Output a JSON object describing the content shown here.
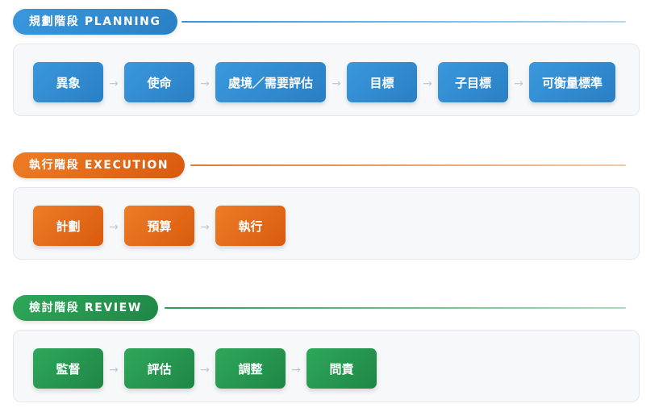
{
  "stages": [
    {
      "title": "規劃階段 PLANNING",
      "color": "#2f8ad0",
      "steps": [
        "異象",
        "使命",
        "處境／需要評估",
        "目標",
        "子目標",
        "可衡量標準"
      ]
    },
    {
      "title": "執行階段 EXECUTION",
      "color": "#e3681a",
      "steps": [
        "計劃",
        "預算",
        "執行"
      ]
    },
    {
      "title": "檢討階段 REVIEW",
      "color": "#27994f",
      "steps": [
        "監督",
        "評估",
        "調整",
        "問責"
      ]
    }
  ],
  "arrow_glyph": "→",
  "icons": {
    "connector": "arrow-right-icon"
  }
}
